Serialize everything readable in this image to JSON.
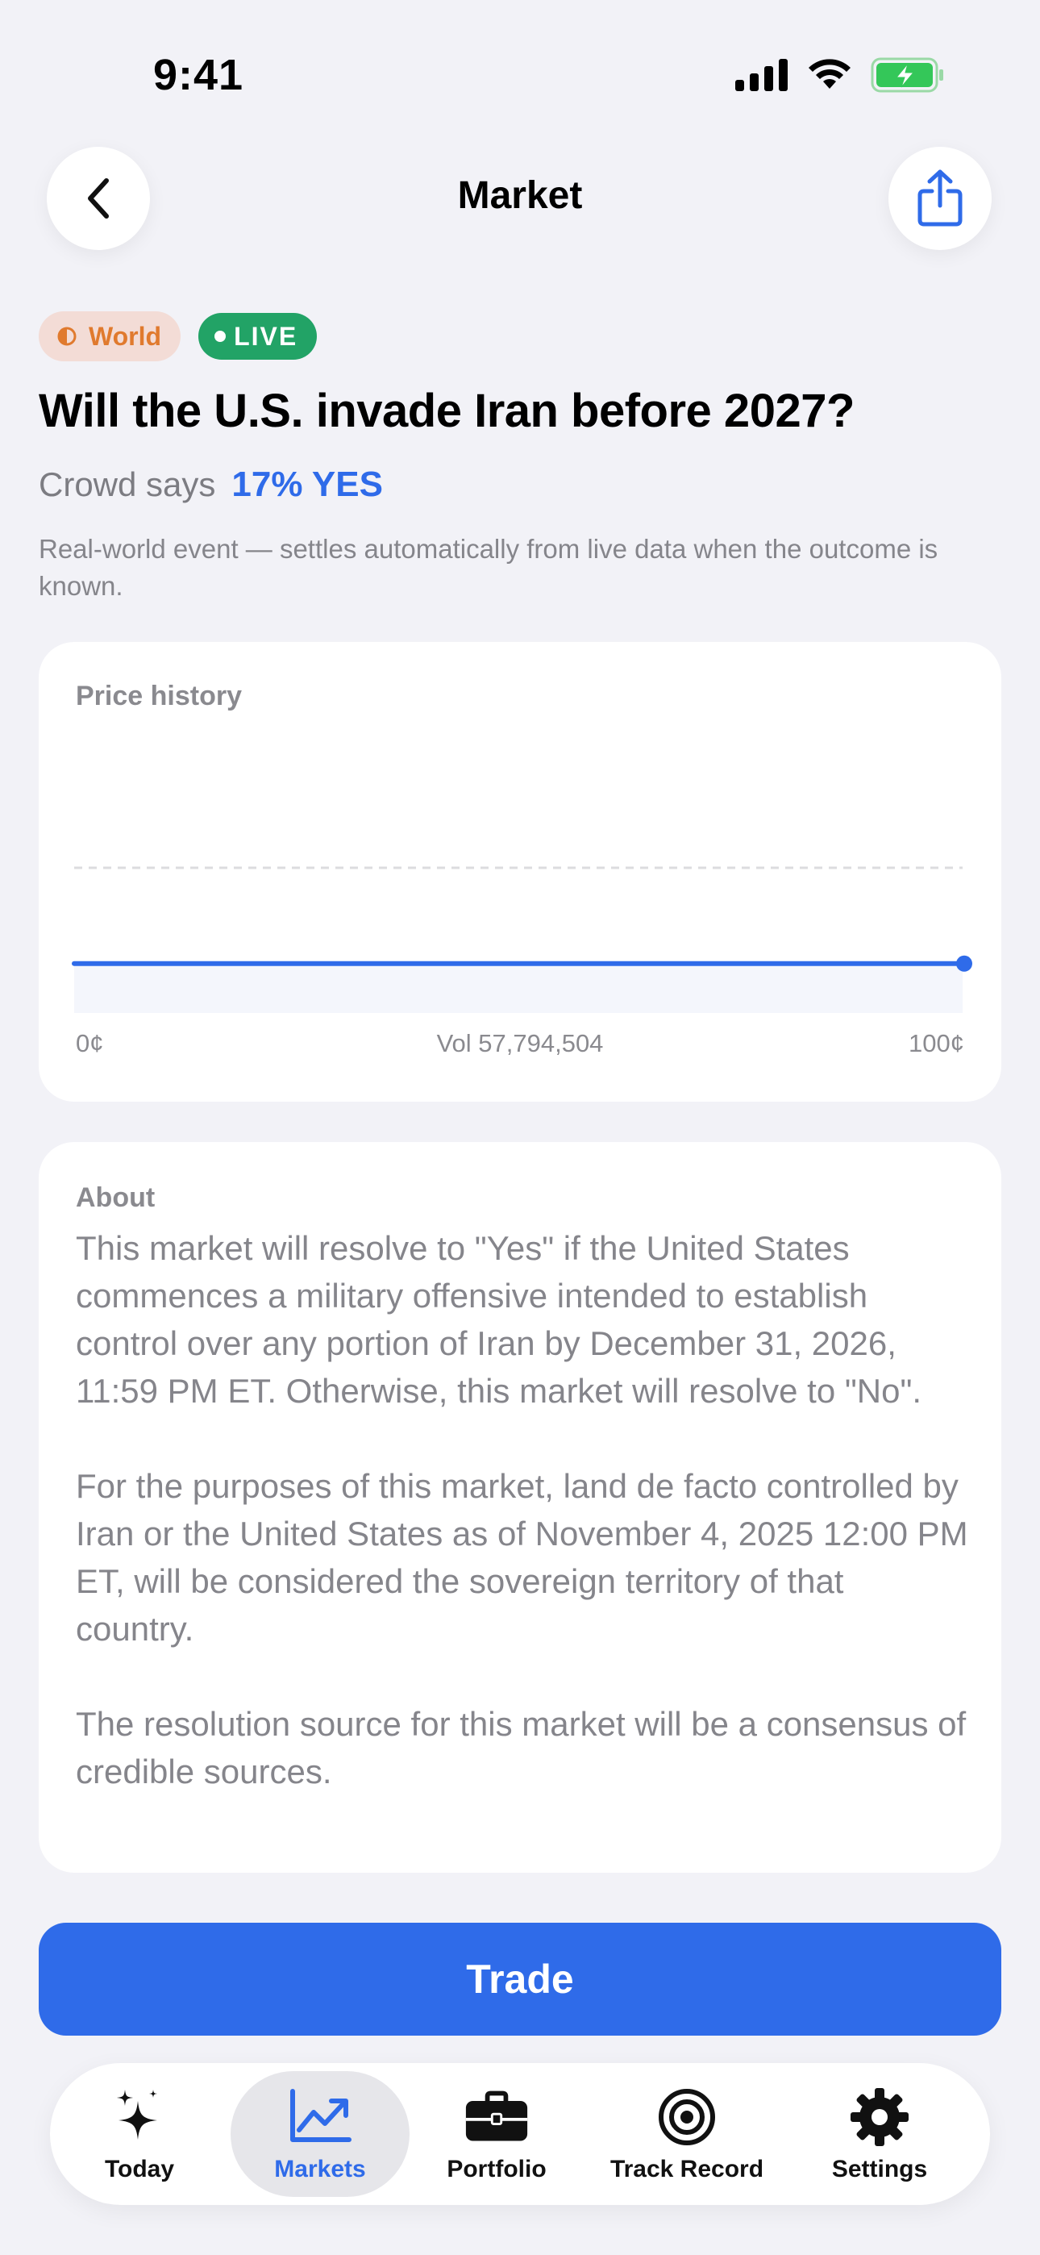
{
  "status_bar": {
    "time": "9:41",
    "icons": [
      "signal-icon",
      "wifi-icon",
      "battery-charging-icon"
    ]
  },
  "header": {
    "title": "Market",
    "back_icon": "chevron-left-icon",
    "share_icon": "share-icon"
  },
  "market": {
    "category_tag": "World",
    "live_tag": "LIVE",
    "question": "Will the U.S. invade Iran before 2027?",
    "crowd_label": "Crowd says",
    "crowd_value": "17% YES",
    "subtitle": "Real-world event — settles automatically from live data when the outcome is known."
  },
  "price_history": {
    "label": "Price history",
    "min_label": "0¢",
    "volume_label": "Vol 57,794,504",
    "max_label": "100¢",
    "line_level": 0.17,
    "reference_level": 0.5
  },
  "about": {
    "label": "About",
    "paragraphs": [
      "This market will resolve to \"Yes\" if the United States commences a military offensive intended to establish control over any portion of Iran by December 31, 2026, 11:59 PM ET. Otherwise, this market will resolve to \"No\".",
      "For the purposes of this market, land de facto controlled by Iran or the United States as of November 4, 2025 12:00 PM ET, will be considered the sovereign territory of that country.",
      "The resolution source for this market will be a consensus of credible sources."
    ]
  },
  "trade_button": "Trade",
  "tabs": [
    {
      "label": "Today",
      "icon": "sparkles-icon",
      "active": false
    },
    {
      "label": "Markets",
      "icon": "chart-trend-icon",
      "active": true
    },
    {
      "label": "Portfolio",
      "icon": "briefcase-icon",
      "active": false
    },
    {
      "label": "Track Record",
      "icon": "target-icon",
      "active": false
    },
    {
      "label": "Settings",
      "icon": "gear-icon",
      "active": false
    }
  ],
  "colors": {
    "accent": "#2f6be9",
    "live_green": "#22a366",
    "world_orange": "#e07a2e",
    "background": "#f2f2f7"
  }
}
